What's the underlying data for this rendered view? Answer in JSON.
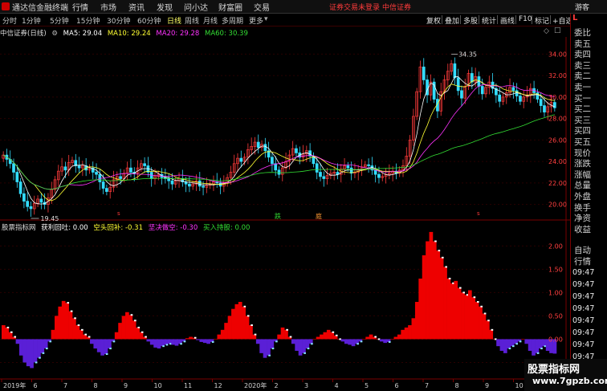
{
  "menubar": {
    "app_title": "通达信金融终端",
    "items": [
      "行情",
      "市场",
      "资讯",
      "发现",
      "问小达",
      "财富圈",
      "交易"
    ],
    "login_status": "证券交易未登录",
    "broker": "中信证券",
    "tourist": "游客"
  },
  "toolbar": {
    "periods": [
      "分时",
      "1分钟",
      "5分钟",
      "15分钟",
      "30分钟",
      "60分钟",
      "日线",
      "周线",
      "月线",
      "多周期",
      "更多"
    ],
    "active_period": "日线",
    "tools": [
      "复权",
      "叠加",
      "多股",
      "统计",
      "画线",
      "F10",
      "标记"
    ],
    "self_select": "+自选"
  },
  "chart_info": {
    "title": "中信证券(日线)",
    "ma5": "MA5: 29.04",
    "ma10": "MA10: 29.24",
    "ma20": "MA20: 29.28",
    "ma60": "MA60: 30.39",
    "colors": {
      "ma5": "#ffffff",
      "ma10": "#ffff33",
      "ma20": "#ff33ff",
      "ma60": "#33dd33"
    }
  },
  "indicator_info": {
    "name": "股票指标网",
    "profit": "获利回吐: 0.00",
    "short": "空头回补: -0.31",
    "firm_short": "坚决做空: -0.30",
    "buy_hold": "买入持股: 0.00",
    "colors": {
      "profit": "#ffffff",
      "short": "#ffff33",
      "firm_short": "#ff33ff",
      "buy_hold": "#33dd33"
    }
  },
  "right_panel": {
    "corner": "L",
    "labels": [
      "委比",
      "卖五",
      "卖四",
      "卖三",
      "卖二",
      "卖一",
      "买一",
      "买二",
      "买三",
      "买四",
      "买五",
      "现价",
      "涨跌",
      "涨幅",
      "总量",
      "外盘",
      "换手",
      "净资",
      "收益"
    ],
    "section": "自动",
    "section2": "行情",
    "times": [
      "09:47",
      "09:47",
      "09:47",
      "09:47",
      "09:47",
      "09:47",
      "09:47",
      "09:47",
      "09:47"
    ]
  },
  "chart_data": {
    "type": "candlestick",
    "price_axis": [
      "34.00",
      "32.00",
      "30.00",
      "28.00",
      "26.00",
      "24.00",
      "22.00",
      "20.00"
    ],
    "ylim": [
      19.0,
      35.0
    ],
    "high_label": "34.35",
    "low_label": "19.45",
    "markers": [
      {
        "text": "跌"
      },
      {
        "text": "庭"
      }
    ],
    "indicator_axis": [
      "2.00",
      "1.50",
      "1.00",
      "0.50",
      "0.00",
      "-0.50"
    ],
    "indicator_ylim": [
      -0.75,
      2.35
    ],
    "x_labels": [
      "2019年",
      "6",
      "7",
      "8",
      "9",
      "10",
      "11",
      "12",
      "2020年",
      "2",
      "3",
      "4",
      "5",
      "6",
      "7",
      "8",
      "9",
      "10",
      "11"
    ],
    "closes": [
      24.6,
      24.2,
      23.8,
      23.0,
      22.1,
      21.0,
      20.3,
      19.8,
      19.6,
      20.1,
      20.5,
      20.2,
      20.0,
      20.6,
      21.4,
      22.3,
      23.1,
      23.5,
      23.2,
      23.9,
      24.1,
      23.6,
      23.4,
      23.6,
      23.2,
      23.4,
      23.0,
      22.8,
      22.1,
      21.5,
      21.2,
      21.6,
      22.3,
      22.6,
      22.4,
      22.9,
      23.4,
      23.0,
      22.9,
      23.4,
      23.8,
      23.6,
      23.0,
      22.4,
      22.6,
      22.8,
      22.5,
      22.4,
      22.2,
      21.9,
      22.2,
      22.4,
      22.1,
      21.9,
      21.7,
      21.9,
      22.2,
      21.7,
      21.6,
      21.8,
      21.9,
      22.1,
      22.0,
      21.7,
      22.0,
      22.5,
      23.0,
      23.8,
      24.3,
      24.0,
      24.4,
      25.1,
      25.4,
      25.8,
      25.3,
      25.6,
      25.0,
      24.4,
      23.8,
      23.2,
      22.8,
      23.4,
      24.0,
      24.6,
      25.2,
      24.8,
      24.4,
      24.7,
      25.0,
      24.5,
      23.8,
      23.0,
      22.6,
      22.4,
      22.7,
      22.9,
      23.0,
      22.8,
      23.3,
      23.6,
      23.4,
      22.9,
      23.0,
      23.2,
      23.5,
      23.7,
      23.6,
      23.2,
      22.8,
      22.5,
      22.6,
      22.8,
      22.9,
      23.1,
      22.9,
      23.2,
      23.6,
      24.5,
      26.0,
      28.2,
      30.5,
      32.8,
      31.6,
      30.2,
      31.4,
      29.8,
      28.7,
      30.5,
      31.6,
      32.4,
      33.1,
      31.8,
      30.6,
      29.9,
      31.0,
      32.2,
      31.4,
      31.9,
      31.0,
      30.3,
      30.9,
      31.4,
      30.8,
      30.2,
      29.6,
      30.0,
      30.4,
      30.9,
      30.6,
      30.1,
      29.6,
      30.0,
      30.2,
      30.8,
      30.4,
      29.8,
      29.2,
      28.6,
      29.1,
      29.5,
      29.0
    ],
    "indicator_values": [
      0.3,
      0.25,
      0.15,
      0.05,
      -0.1,
      -0.35,
      -0.5,
      -0.58,
      -0.62,
      -0.5,
      -0.4,
      -0.3,
      -0.2,
      -0.05,
      0.2,
      0.5,
      0.7,
      0.82,
      0.78,
      0.6,
      0.45,
      0.3,
      0.2,
      0.1,
      0.05,
      -0.1,
      -0.2,
      -0.28,
      -0.35,
      -0.32,
      -0.2,
      -0.05,
      0.15,
      0.35,
      0.5,
      0.58,
      0.52,
      0.4,
      0.25,
      0.15,
      0.05,
      -0.05,
      -0.12,
      -0.18,
      -0.2,
      -0.15,
      -0.12,
      -0.1,
      -0.12,
      -0.14,
      -0.1,
      -0.05,
      0.02,
      0.05,
      0.03,
      -0.02,
      -0.06,
      -0.08,
      -0.1,
      -0.06,
      0.0,
      0.1,
      0.2,
      0.35,
      0.5,
      0.65,
      0.75,
      0.8,
      0.7,
      0.5,
      0.3,
      0.1,
      -0.1,
      -0.3,
      -0.4,
      -0.35,
      -0.2,
      -0.05,
      0.1,
      0.25,
      0.2,
      0.05,
      -0.1,
      -0.25,
      -0.35,
      -0.3,
      -0.2,
      -0.1,
      0.0,
      0.05,
      0.1,
      0.15,
      0.2,
      0.15,
      0.08,
      0.0,
      -0.05,
      -0.1,
      -0.12,
      -0.15,
      -0.1,
      -0.05,
      0.0,
      0.05,
      0.1,
      0.05,
      0.0,
      -0.05,
      -0.08,
      -0.06,
      0.0,
      0.05,
      0.1,
      0.2,
      0.25,
      0.3,
      0.45,
      0.8,
      1.3,
      1.8,
      2.1,
      2.3,
      2.1,
      1.9,
      1.75,
      1.55,
      1.3,
      1.2,
      1.25,
      1.1,
      1.0,
      0.95,
      1.05,
      0.9,
      0.8,
      0.7,
      0.55,
      0.4,
      0.2,
      0.0,
      -0.15,
      -0.25,
      -0.3,
      -0.2,
      -0.15,
      -0.1,
      -0.05,
      0.0,
      -0.1,
      -0.25,
      -0.35,
      -0.3,
      -0.2,
      -0.15,
      -0.25,
      -0.3,
      -0.31
    ]
  }
}
